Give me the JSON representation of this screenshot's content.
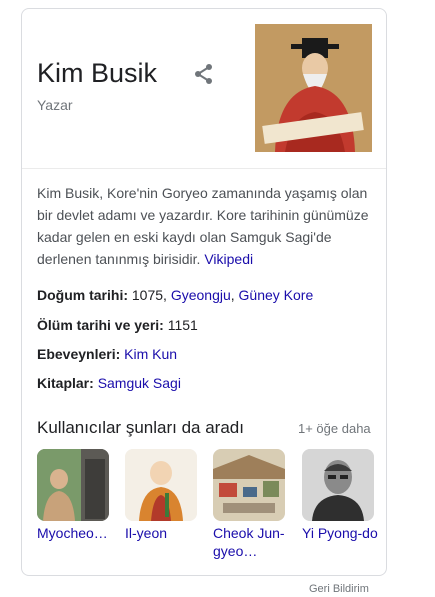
{
  "panel": {
    "title": "Kim Busik",
    "subtitle": "Yazar",
    "description": "Kim Busik, Kore'nin Goryeo zamanında yaşamış olan bir devlet adamı ve yazardır. Kore tarihinin günümüze kadar gelen en eski kaydı olan Samguk Sagi'de derlenen tanınmış birisidir.",
    "source_link": "Vikipedi"
  },
  "facts": [
    {
      "label": "Doğum tarihi:",
      "plain": " 1075, ",
      "link1": "Gyeongju",
      "sep": ", ",
      "link2": "Güney Kore"
    },
    {
      "label": "Ölüm tarihi ve yeri:",
      "plain": " 1151"
    },
    {
      "label": "Ebeveynleri:",
      "link1": "Kim Kun"
    },
    {
      "label": "Kitaplar:",
      "link1": "Samguk Sagi"
    }
  ],
  "people_also_search": {
    "title": "Kullanıcılar şunları da aradı",
    "more": "1+ öğe daha",
    "items": [
      {
        "label": "Myocheo…"
      },
      {
        "label": "Il-yeon"
      },
      {
        "label": "Cheok Jun-gyeo…"
      },
      {
        "label": "Yi Pyong-do"
      }
    ]
  },
  "footer": {
    "feedback": "Geri Bildirim"
  },
  "colors": {
    "link": "#1a0dab",
    "muted": "#70757a",
    "text": "#202124",
    "border": "#dadce0"
  },
  "icons": [
    "share-icon"
  ]
}
